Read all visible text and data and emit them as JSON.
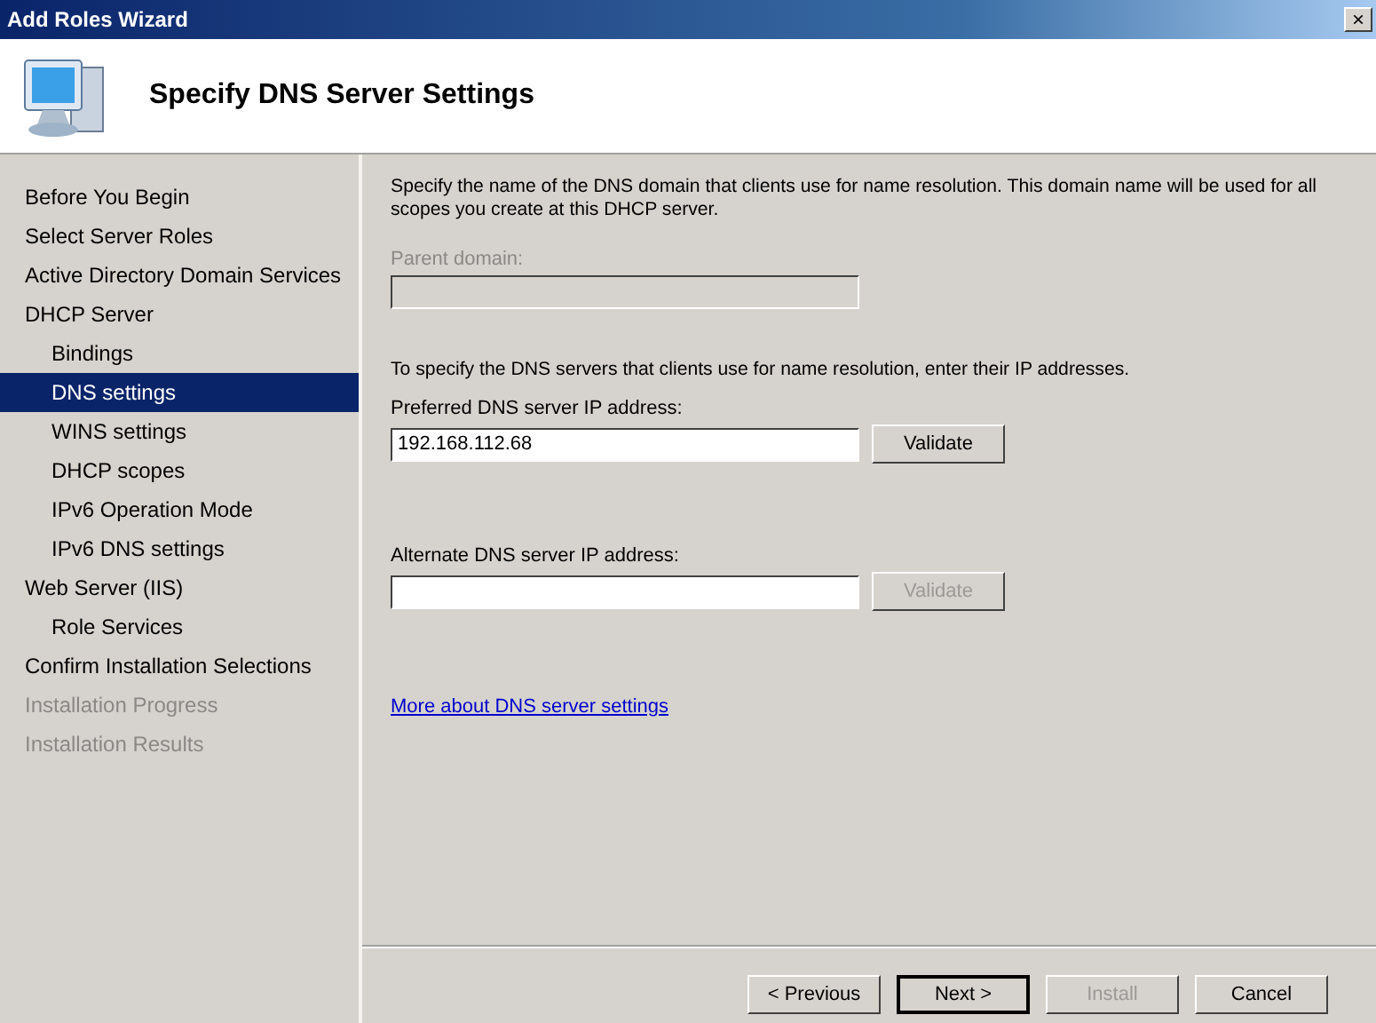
{
  "window": {
    "title": "Add Roles Wizard",
    "close": "×"
  },
  "header": {
    "title": "Specify DNS Server Settings"
  },
  "sidebar": {
    "items": [
      {
        "label": "Before You Begin",
        "selected": false,
        "disabled": false
      },
      {
        "label": "Select Server Roles",
        "selected": false,
        "disabled": false
      },
      {
        "label": "Active Directory Domain Services",
        "selected": false,
        "disabled": false
      },
      {
        "label": "DHCP Server",
        "selected": false,
        "disabled": false,
        "children": [
          {
            "label": "Bindings",
            "selected": false,
            "disabled": false
          },
          {
            "label": "DNS settings",
            "selected": true,
            "disabled": false
          },
          {
            "label": "WINS settings",
            "selected": false,
            "disabled": false
          },
          {
            "label": "DHCP scopes",
            "selected": false,
            "disabled": false
          },
          {
            "label": "IPv6 Operation Mode",
            "selected": false,
            "disabled": false
          },
          {
            "label": "IPv6 DNS settings",
            "selected": false,
            "disabled": false
          }
        ]
      },
      {
        "label": "Web Server (IIS)",
        "selected": false,
        "disabled": false,
        "children": [
          {
            "label": "Role Services",
            "selected": false,
            "disabled": false
          }
        ]
      },
      {
        "label": "Confirm Installation Selections",
        "selected": false,
        "disabled": false
      },
      {
        "label": "Installation Progress",
        "selected": false,
        "disabled": true
      },
      {
        "label": "Installation Results",
        "selected": false,
        "disabled": true
      }
    ]
  },
  "content": {
    "intro": "Specify the name of the DNS domain that clients use for name resolution.  This domain name will be used for all scopes you create at this DHCP server.",
    "parent_domain": {
      "label": "Parent domain:",
      "disabled": true
    },
    "servers_note": "To specify the DNS servers that clients use for name resolution, enter their IP addresses.",
    "preferred": {
      "label": "Preferred DNS server IP address:",
      "value": "192.168.112.68",
      "button": {
        "label": "Validate",
        "disabled": false
      }
    },
    "alternate": {
      "label": "Alternate DNS server IP address:",
      "button": {
        "label": "Validate",
        "disabled": true
      }
    },
    "link": "More about DNS server settings"
  },
  "buttons": [
    {
      "label": "< Previous",
      "disabled": false,
      "default": false
    },
    {
      "label": "Next >",
      "disabled": false,
      "default": true
    },
    {
      "label": "Install",
      "disabled": true,
      "default": false
    },
    {
      "label": "Cancel",
      "disabled": false,
      "default": false
    }
  ]
}
